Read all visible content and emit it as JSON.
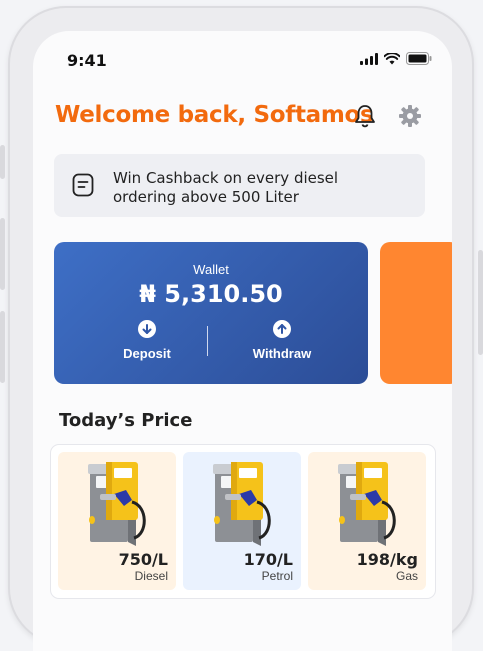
{
  "status_bar": {
    "time": "9:41"
  },
  "header": {
    "welcome": "Welcome back, Softamos"
  },
  "promo": {
    "text": "Win Cashback on every diesel ordering above 500 Liter"
  },
  "wallet": {
    "label": "Wallet",
    "balance": "₦ 5,310.50",
    "deposit_label": "Deposit",
    "withdraw_label": "Withdraw"
  },
  "prices": {
    "title": "Today’s Price",
    "items": [
      {
        "price": "750/L",
        "name": "Diesel",
        "bg": "#fff3e4"
      },
      {
        "price": "170/L",
        "name": "Petrol",
        "bg": "#eaf2fe"
      },
      {
        "price": "198/kg",
        "name": "Gas",
        "bg": "#fff3e4"
      }
    ]
  },
  "colors": {
    "accent": "#f26a0e",
    "wallet_blue": "#3e6fc6",
    "orange_card": "#ff8630"
  },
  "icons": [
    "bell-icon",
    "gear-icon",
    "document-icon",
    "arrow-down-icon",
    "arrow-up-icon",
    "fuel-pump-icon"
  ]
}
